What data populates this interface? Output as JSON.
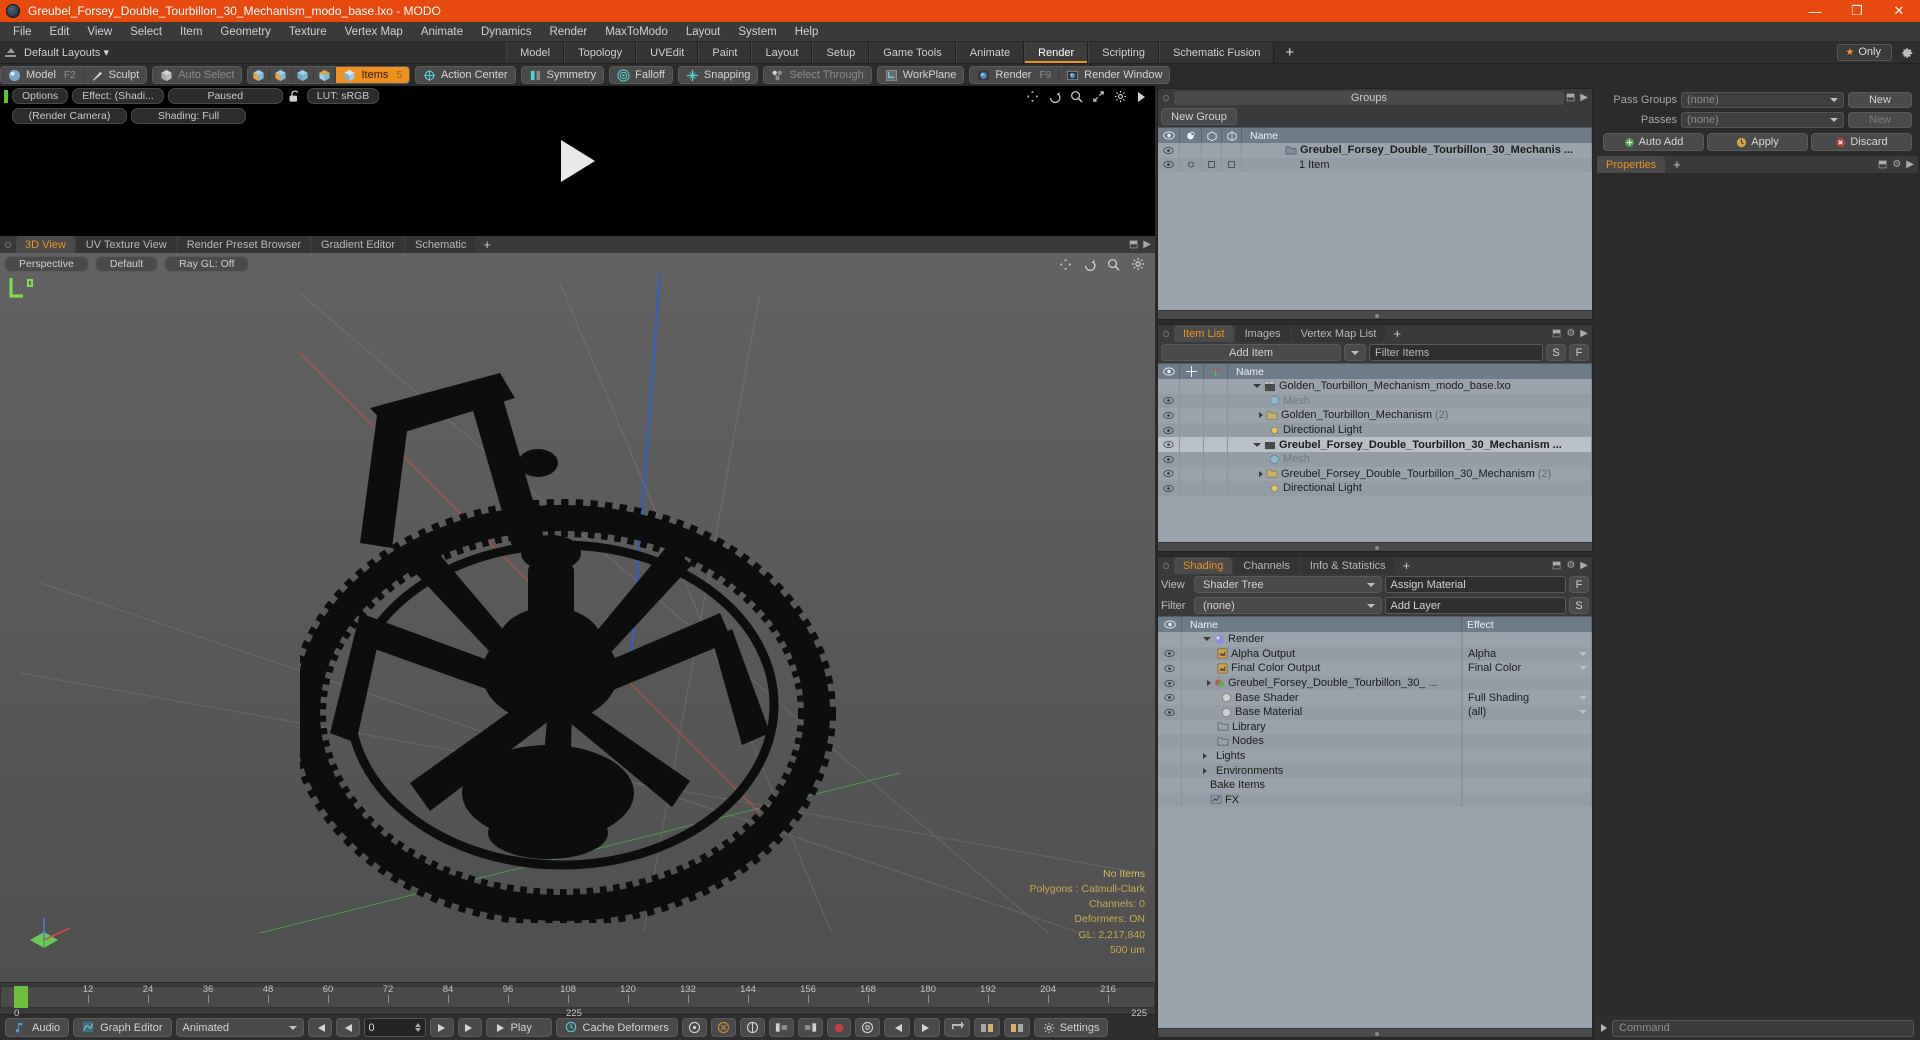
{
  "window": {
    "title": "Greubel_Forsey_Double_Tourbillon_30_Mechanism_modo_base.lxo - MODO",
    "minimize": "—",
    "maximize": "❐",
    "close": "✕"
  },
  "menubar": {
    "items": [
      "File",
      "Edit",
      "View",
      "Select",
      "Item",
      "Geometry",
      "Texture",
      "Vertex Map",
      "Animate",
      "Dynamics",
      "Render",
      "MaxToModo",
      "Layout",
      "System",
      "Help"
    ]
  },
  "layout_row": {
    "default_layouts": "Default Layouts",
    "caret": "▾",
    "tabs": [
      {
        "label": "Model",
        "active": false
      },
      {
        "label": "Topology",
        "active": false
      },
      {
        "label": "UVEdit",
        "active": false
      },
      {
        "label": "Paint",
        "active": false
      },
      {
        "label": "Layout",
        "active": false
      },
      {
        "label": "Setup",
        "active": false
      },
      {
        "label": "Game Tools",
        "active": false
      },
      {
        "label": "Animate",
        "active": false
      },
      {
        "label": "Render",
        "active": true
      },
      {
        "label": "Scripting",
        "active": false
      },
      {
        "label": "Schematic Fusion",
        "active": false
      }
    ],
    "add_tab": "+",
    "only_label": "Only",
    "star": "★",
    "accent": "#f0901e"
  },
  "toolbar": {
    "mode_model": "Model",
    "mode_model_hotkey": "F2",
    "mode_sculpt": "Sculpt",
    "auto_select": "Auto Select",
    "items": "Items",
    "items_hotkey": "5",
    "action_center": "Action Center",
    "symmetry": "Symmetry",
    "falloff": "Falloff",
    "snapping": "Snapping",
    "select_through": "Select Through",
    "workplane": "WorkPlane",
    "render": "Render",
    "render_hotkey": "F9",
    "render_window": "Render Window"
  },
  "preview": {
    "options": "Options",
    "effect": "Effect: (Shadi...",
    "paused": "Paused",
    "lut": "LUT: sRGB",
    "render_camera": "(Render Camera)",
    "shading": "Shading: Full",
    "tools": [
      "move-icon",
      "rotate-icon",
      "zoom-icon",
      "fit-icon",
      "gear-icon",
      "play-icon"
    ]
  },
  "viewport": {
    "tabs": [
      {
        "label": "3D View",
        "active": true
      },
      {
        "label": "UV Texture View",
        "active": false
      },
      {
        "label": "Render Preset Browser",
        "active": false
      },
      {
        "label": "Gradient Editor",
        "active": false
      },
      {
        "label": "Schematic",
        "active": false
      }
    ],
    "add_tab": "+",
    "view_mode": "Perspective",
    "shading_preset": "Default",
    "raygl": "Ray GL: Off",
    "stats": {
      "items": "No Items",
      "polygons": "Polygons : Catmull-Clark",
      "channels": "Channels: 0",
      "deformers": "Deformers: ON",
      "gl": "GL: 2,217,840",
      "scale": "500 um"
    }
  },
  "timeline": {
    "ticks": [
      0,
      12,
      24,
      36,
      48,
      60,
      72,
      84,
      96,
      108,
      120,
      132,
      144,
      156,
      168,
      180,
      192,
      204,
      216
    ],
    "start_label": "0",
    "end_label": "225",
    "mid_label": "225"
  },
  "bottombar": {
    "audio": "Audio",
    "graph_editor": "Graph Editor",
    "animated": "Animated",
    "frame_value": "0",
    "play": "Play",
    "cache_deformers": "Cache Deformers",
    "settings": "Settings"
  },
  "groups_panel": {
    "title": "Groups",
    "new_group": "New Group",
    "columns": [
      "eye-icon",
      "render-icon",
      "shape-icon",
      "shade-icon",
      "Name"
    ],
    "rows": [
      {
        "name": "Greubel_Forsey_Double_Tourbillon_30_Mechanis ...",
        "bold": true,
        "eye": true
      },
      {
        "name": "1 Item",
        "bold": false,
        "eye": true
      }
    ]
  },
  "item_list_panel": {
    "tabs": [
      {
        "label": "Item List",
        "active": true
      },
      {
        "label": "Images",
        "active": false
      },
      {
        "label": "Vertex Map List",
        "active": false
      }
    ],
    "add_tab": "+",
    "add_item": "Add Item",
    "filter_items": "Filter Items",
    "btn_s": "S",
    "btn_f": "F",
    "columns": [
      "eye-icon",
      "move-icon",
      "axis-icon",
      "Name"
    ],
    "rows": [
      {
        "name": "Golden_Tourbillon_Mechanism_modo_base.lxo",
        "icon": "scene-icon",
        "depth": 0,
        "expander": "down",
        "eye": false,
        "bold": false
      },
      {
        "name": "Mesh",
        "icon": "mesh-icon",
        "depth": 1,
        "expander": "",
        "eye": true,
        "bold": false,
        "muted": true
      },
      {
        "name": "Golden_Tourbillon_Mechanism",
        "suffix": "(2)",
        "icon": "group-icon",
        "depth": 1,
        "expander": "right",
        "eye": true,
        "bold": false
      },
      {
        "name": "Directional Light",
        "icon": "light-icon",
        "depth": 1,
        "expander": "",
        "eye": true,
        "bold": false
      },
      {
        "name": "Greubel_Forsey_Double_Tourbillon_30_Mechanism ...",
        "icon": "scene-icon",
        "depth": 0,
        "expander": "down",
        "eye": true,
        "bold": true
      },
      {
        "name": "Mesh",
        "icon": "mesh-icon",
        "depth": 1,
        "expander": "",
        "eye": true,
        "bold": false,
        "muted": true
      },
      {
        "name": "Greubel_Forsey_Double_Tourbillon_30_Mechanism",
        "suffix": "(2)",
        "icon": "group-icon",
        "depth": 1,
        "expander": "right",
        "eye": true,
        "bold": false
      },
      {
        "name": "Directional Light",
        "icon": "light-icon",
        "depth": 1,
        "expander": "",
        "eye": true,
        "bold": false
      }
    ]
  },
  "shading_panel": {
    "tabs": [
      {
        "label": "Shading",
        "active": true
      },
      {
        "label": "Channels",
        "active": false
      },
      {
        "label": "Info & Statistics",
        "active": false
      }
    ],
    "add_tab": "+",
    "view_label": "View",
    "view_value": "Shader Tree",
    "assign_material": "Assign Material",
    "btn_f": "F",
    "filter_label": "Filter",
    "filter_value": "(none)",
    "add_layer": "Add Layer",
    "btn_s": "S",
    "col_name": "Name",
    "col_effect": "Effect",
    "rows": [
      {
        "name": "Render",
        "effect": "",
        "icon": "sphere-icon",
        "depth": 0,
        "expander": "down",
        "eye": false
      },
      {
        "name": "Alpha Output",
        "effect": "Alpha",
        "icon": "output-icon",
        "depth": 1,
        "expander": "",
        "eye": true,
        "dropdown": true
      },
      {
        "name": "Final Color Output",
        "effect": "Final Color",
        "icon": "output-icon",
        "depth": 1,
        "expander": "",
        "eye": true,
        "dropdown": true
      },
      {
        "name": "Greubel_Forsey_Double_Tourbillon_30_ ...",
        "effect": "",
        "icon": "material-icon",
        "depth": 1,
        "expander": "right",
        "eye": true
      },
      {
        "name": "Base Shader",
        "effect": "Full Shading",
        "icon": "shader-icon",
        "depth": 2,
        "expander": "",
        "eye": true,
        "dropdown": true
      },
      {
        "name": "Base Material",
        "effect": "(all)",
        "icon": "shader-icon",
        "depth": 2,
        "expander": "",
        "eye": true,
        "dropdown": true
      },
      {
        "name": "Library",
        "effect": "",
        "icon": "folder-icon",
        "depth": 1,
        "expander": "",
        "eye": false
      },
      {
        "name": "Nodes",
        "effect": "",
        "icon": "folder-icon",
        "depth": 1,
        "expander": "",
        "eye": false
      },
      {
        "name": "Lights",
        "effect": "",
        "icon": "",
        "depth": 0,
        "expander": "right",
        "eye": false
      },
      {
        "name": "Environments",
        "effect": "",
        "icon": "",
        "depth": 0,
        "expander": "right",
        "eye": false
      },
      {
        "name": "Bake Items",
        "effect": "",
        "icon": "",
        "depth": 0,
        "expander": "",
        "eye": false
      },
      {
        "name": "FX",
        "effect": "",
        "icon": "fx-icon",
        "depth": 0,
        "expander": "",
        "eye": false
      }
    ]
  },
  "right_panel": {
    "pass_groups_label": "Pass Groups",
    "pass_groups_value": "(none)",
    "passes_label": "Passes",
    "passes_value": "(none)",
    "new_btn": "New",
    "new_btn2": "New",
    "auto_add": "Auto Add",
    "apply": "Apply",
    "discard": "Discard",
    "properties_tab": "Properties",
    "add_tab": "+",
    "command_placeholder": "Command"
  }
}
